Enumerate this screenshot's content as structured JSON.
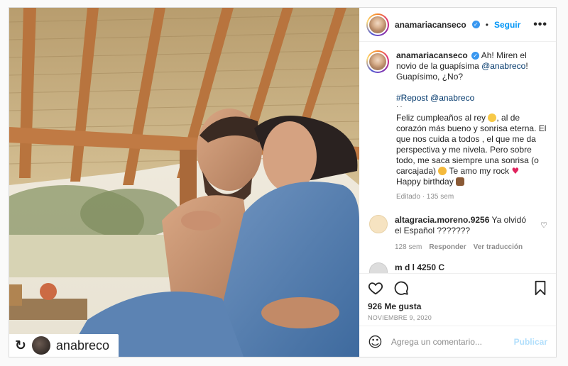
{
  "post": {
    "username": "anamariacanseco",
    "follow_label": "Seguir",
    "more_label": "•••",
    "separator": "•",
    "repost_badge": {
      "icon": "repost-icon",
      "glyph": "↻",
      "username": "anabreco"
    }
  },
  "caption": {
    "username": "anamariacanseco",
    "text_1": "Ah! Miren el novio de la guapísima ",
    "mention_1": "@anabreco",
    "text_2": "! Guapísimo, ¿No?",
    "repost_tag": "#Repost @anabreco",
    "dots": "· ·",
    "body_1": "Feliz cumpleaños al rey ",
    "body_2": ", al de corazón más bueno y sonrisa eterna. El que nos cuida a todos , el que me da perspectiva y me nivela. Pero sobre todo, me saca siempre una sonrisa (o carcajada) ",
    "body_3": " Te amo my rock ",
    "body_4": "Happy birthday ",
    "meta": "Editado · 135 sem"
  },
  "comment": {
    "username": "altagracia.moreno.9256",
    "text": " Ya olvidó el Español ???????",
    "time": "128 sem",
    "reply_label": "Responder",
    "translate_label": "Ver traducción",
    "like_glyph": "♡"
  },
  "cut_comment": {
    "username": "m   d   l   4250 C"
  },
  "stats": {
    "likes": "926 Me gusta",
    "date": "NOVIEMBRE 9, 2020"
  },
  "add_comment": {
    "emoji_glyph": "☺",
    "placeholder": "Agrega un comentario...",
    "publish_label": "Publicar"
  },
  "colors": {
    "accent": "#0095f6",
    "link": "#00376b",
    "muted": "#8e8e8e",
    "verified": "#3897f0",
    "heart": "#e0245e"
  }
}
